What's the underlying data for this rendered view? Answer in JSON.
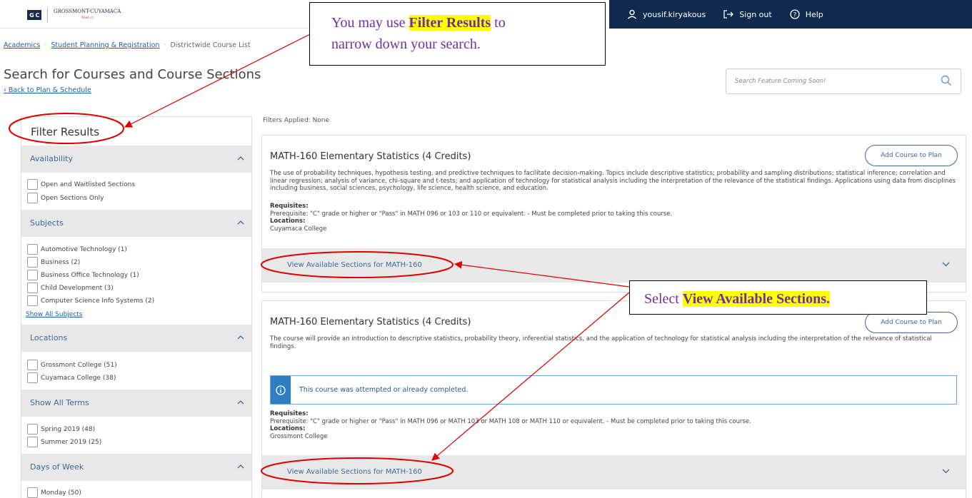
{
  "logo": {
    "mark": "G C",
    "name": "GROSSMONT-CUYAMACA",
    "sub": "Tout ci"
  },
  "topnav": {
    "user": "yousif.kiryakous",
    "signout": "Sign out",
    "help": "Help"
  },
  "breadcrumb": [
    "Academics",
    "Student Planning & Registration",
    "Districtwide Course List"
  ],
  "page_title": "Search for Courses and Course Sections",
  "back_link": "Back to Plan & Schedule",
  "search": {
    "placeholder": "Search Feature Coming Soon!"
  },
  "filters": {
    "title": "Filter Results",
    "availability": {
      "header": "Availability",
      "options": [
        "Open and Waitlisted Sections",
        "Open Sections Only"
      ]
    },
    "subjects": {
      "header": "Subjects",
      "options": [
        "Automotive Technology (1)",
        "Business (2)",
        "Business Office Technology (1)",
        "Child Development (3)",
        "Computer Science Info Systems (2)"
      ],
      "show_all": "Show All Subjects"
    },
    "locations": {
      "header": "Locations",
      "options": [
        "Grossmont College (51)",
        "Cuyamaca College (38)"
      ]
    },
    "terms": {
      "header": "Show All Terms",
      "options": [
        "Spring 2019 (48)",
        "Summer 2019 (25)"
      ]
    },
    "days": {
      "header": "Days of Week",
      "options": [
        "Monday (50)"
      ]
    }
  },
  "filters_applied": "Filters Applied: None",
  "courses": [
    {
      "title": "MATH-160 Elementary Statistics (4 Credits)",
      "add_label": "Add Course to Plan",
      "desc": "The use of probability techniques, hypothesis testing, and predictive techniques to facilitate decision-making. Topics include descriptive statistics; probability and sampling distributions; statistical inference; correlation and linear regression; analysis of variance, chi-square and t-tests; and application of technology for statistical analysis including the interpretation of the relevance of the statistical findings. Applications using data from disciplines including business, social sciences, psychology, life science, health science, and education.",
      "requisites_label": "Requisites:",
      "requisites": "Prerequisite: \"C\" grade or higher or \"Pass\" in MATH 096 or 103 or 110 or equivalent. - Must be completed prior to taking this course.",
      "locations_label": "Locations:",
      "location": "Cuyamaca College",
      "sections_label": "View Available Sections for MATH-160"
    },
    {
      "title": "MATH-160 Elementary Statistics (4 Credits)",
      "add_label": "Add Course to Plan",
      "desc": "The course will provide an introduction to descriptive statistics, probability theory, inferential statistics, and the application of technology for statistical analysis including the interpretation of the relevance of statistical findings.",
      "notice": "This course was attempted or already completed.",
      "requisites_label": "Requisites:",
      "requisites": "Prerequisite: \"C\" grade or higher or \"Pass\" in MATH 096 or MATH 103 or MATH 108 or MATH 110 or equivalent. - Must be completed prior to taking this course.",
      "locations_label": "Locations:",
      "location": "Grossmont College",
      "sections_label": "View Available Sections for MATH-160"
    }
  ],
  "callouts": {
    "filter": {
      "pre": "You may use ",
      "highlight": "Filter Results",
      "post": " to",
      "line2": "narrow down your search."
    },
    "sections": {
      "pre": "Select ",
      "highlight": "View Available Sections."
    }
  },
  "colors": {
    "nav": "#0f2a4d",
    "link": "#1d5ea8",
    "annotation": "#e00000",
    "callout_text": "#7030a0",
    "highlight": "#ffff00"
  }
}
